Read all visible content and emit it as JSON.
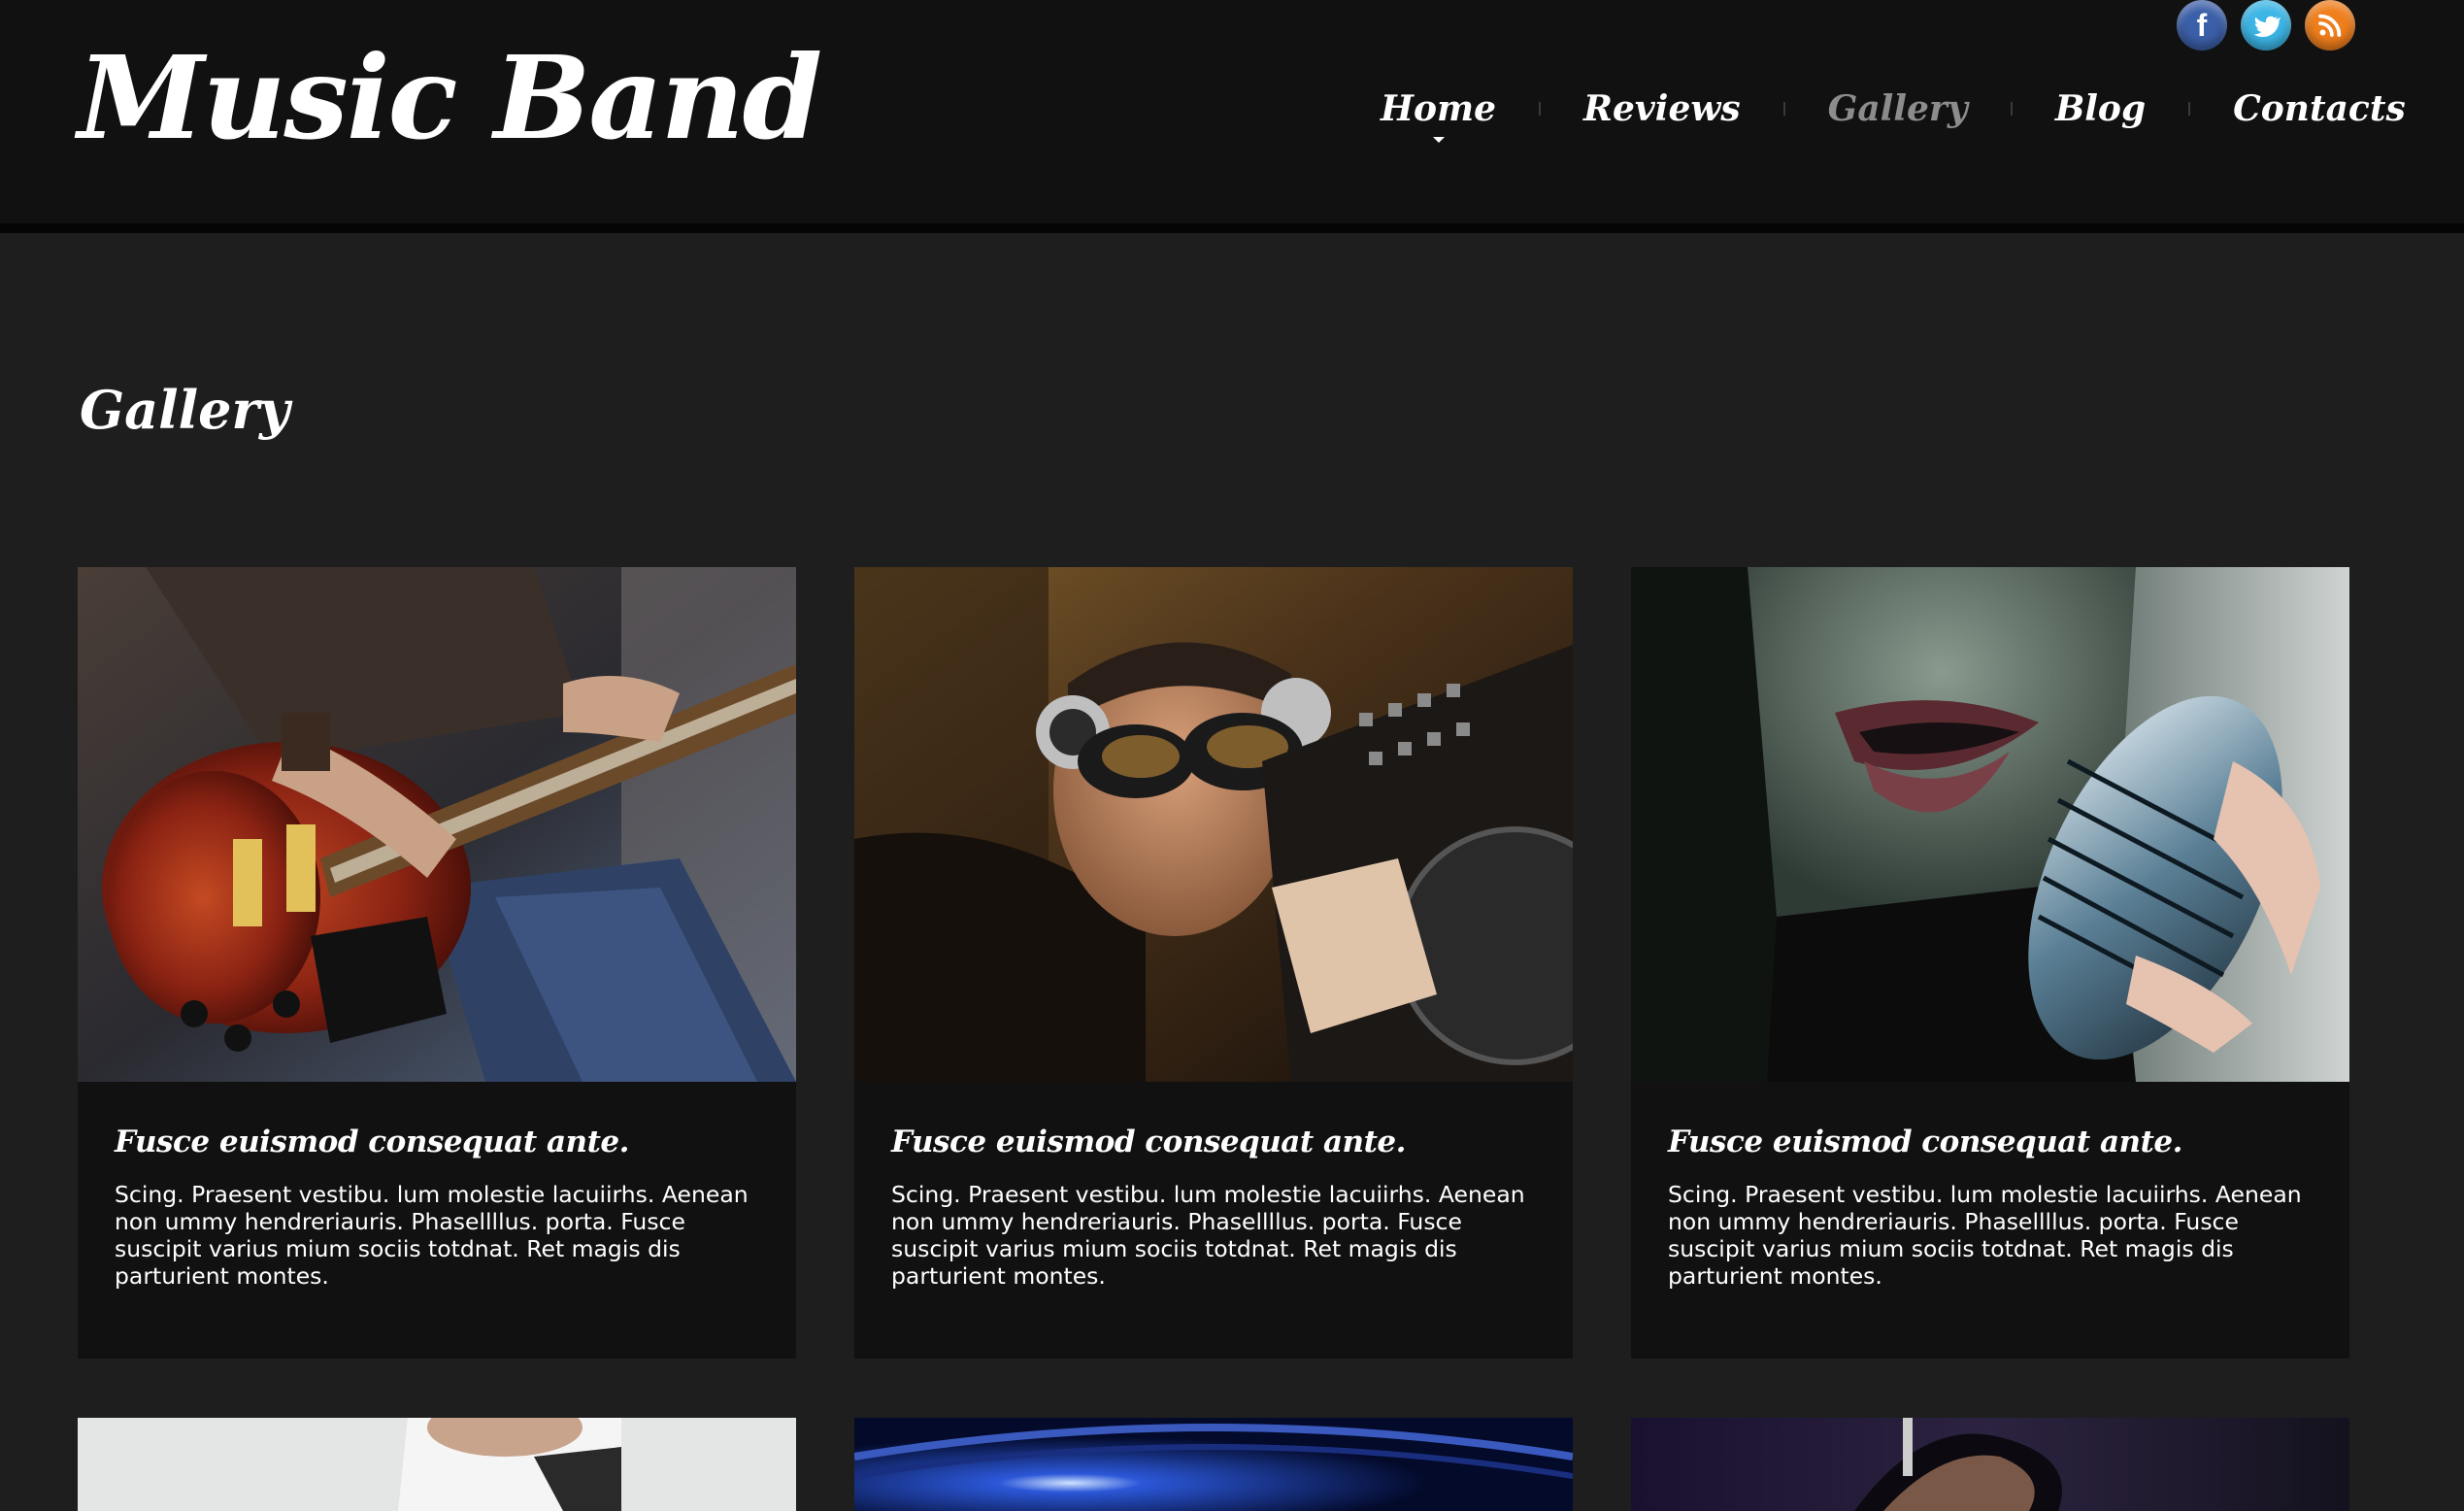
{
  "header": {
    "logo": "Music Band",
    "social": [
      {
        "name": "facebook",
        "icon": "facebook-icon",
        "glyph": "f",
        "color": "#3b5fa8"
      },
      {
        "name": "twitter",
        "icon": "twitter-icon",
        "color": "#3bb5e6"
      },
      {
        "name": "rss",
        "icon": "rss-icon",
        "color": "#ef7e1c"
      }
    ],
    "nav": [
      {
        "label": "Home",
        "state": "hover"
      },
      {
        "label": "Reviews"
      },
      {
        "label": "Gallery",
        "state": "active"
      },
      {
        "label": "Blog"
      },
      {
        "label": "Contacts"
      }
    ]
  },
  "main": {
    "title": "Gallery",
    "items": [
      {
        "image": "guitarist-photo",
        "title": "Fusce euismod consequat ante.",
        "text": "Scing. Praesent vestibu. lum molestie lacuiirhs. Aenean non ummy hendreriauris. Phasellllus. porta. Fusce suscipit varius mium sociis totdnat. Ret magis dis parturient montes."
      },
      {
        "image": "dj-photo",
        "title": "Fusce euismod consequat ante.",
        "text": "Scing. Praesent vestibu. lum molestie lacuiirhs. Aenean non ummy hendreriauris. Phasellllus. porta. Fusce suscipit varius mium sociis totdnat. Ret magis dis parturient montes."
      },
      {
        "image": "singer-photo",
        "title": "Fusce euismod consequat ante.",
        "text": "Scing. Praesent vestibu. lum molestie lacuiirhs. Aenean non ummy hendreriauris. Phasellllus. porta. Fusce suscipit varius mium sociis totdnat. Ret magis dis parturient montes."
      },
      {
        "image": "performer-photo"
      },
      {
        "image": "stage-lights-photo"
      },
      {
        "image": "crowd-photo"
      }
    ]
  },
  "colors": {
    "page_bg": "#1e1e1f",
    "header_bg": "#111112",
    "card_bg": "#111111",
    "text": "#ffffff",
    "nav_active": "#8c8c8c"
  }
}
